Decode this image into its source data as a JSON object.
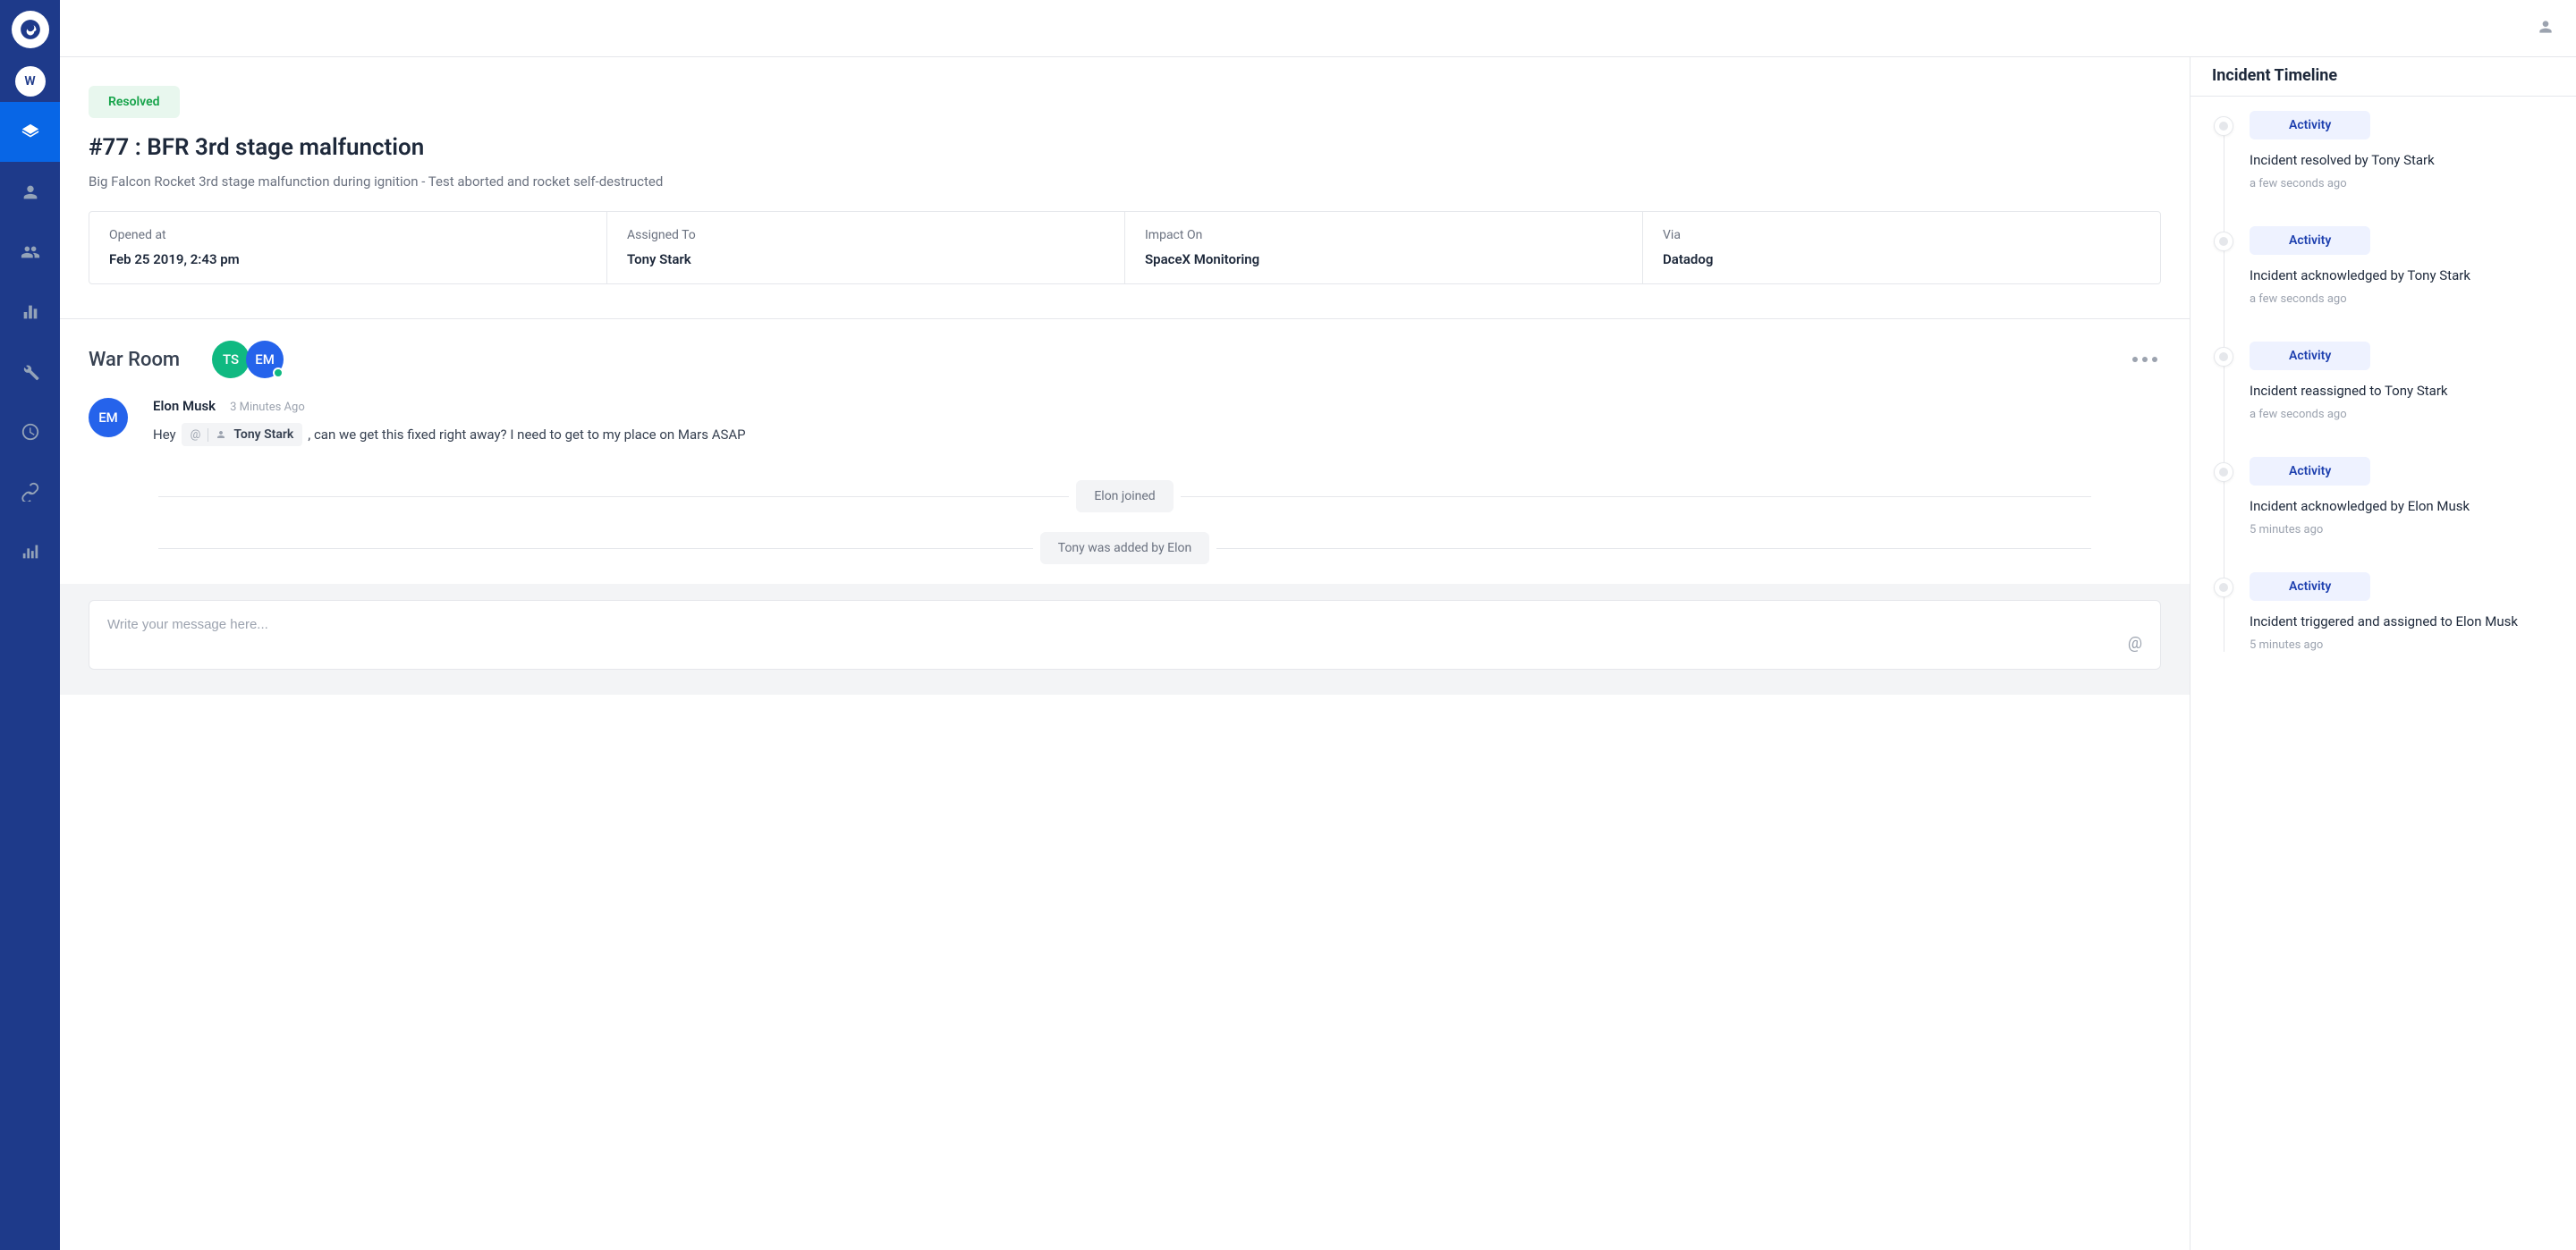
{
  "sidebar": {
    "workspace_initial": "W"
  },
  "incident": {
    "status": "Resolved",
    "title": "#77 : BFR 3rd stage malfunction",
    "description": "Big Falcon Rocket 3rd stage malfunction during ignition - Test aborted and rocket self-destructed",
    "meta": {
      "opened_label": "Opened at",
      "opened_value": "Feb 25 2019, 2:43 pm",
      "assigned_label": "Assigned To",
      "assigned_value": "Tony Stark",
      "impact_label": "Impact On",
      "impact_value": "SpaceX Monitoring",
      "via_label": "Via",
      "via_value": "Datadog"
    }
  },
  "warroom": {
    "title": "War Room",
    "participants": [
      {
        "initials": "TS"
      },
      {
        "initials": "EM"
      }
    ],
    "message": {
      "author_initials": "EM",
      "author": "Elon Musk",
      "time": "3 Minutes Ago",
      "text_before": "Hey",
      "mention": "Tony Stark",
      "text_after": ", can we get this fixed right away? I need to get to my place on Mars ASAP"
    },
    "system_notices": [
      "Elon joined",
      "Tony was added by Elon"
    ],
    "composer_placeholder": "Write your message here..."
  },
  "timeline": {
    "title": "Incident Timeline",
    "activity_label": "Activity",
    "items": [
      {
        "text": "Incident resolved by Tony Stark",
        "time": "a few seconds ago"
      },
      {
        "text": "Incident acknowledged by Tony Stark",
        "time": "a few seconds ago"
      },
      {
        "text": "Incident reassigned to Tony Stark",
        "time": "a few seconds ago"
      },
      {
        "text": "Incident acknowledged by Elon Musk",
        "time": "5 minutes ago"
      },
      {
        "text": "Incident triggered and assigned to Elon Musk",
        "time": "5 minutes ago"
      }
    ]
  }
}
